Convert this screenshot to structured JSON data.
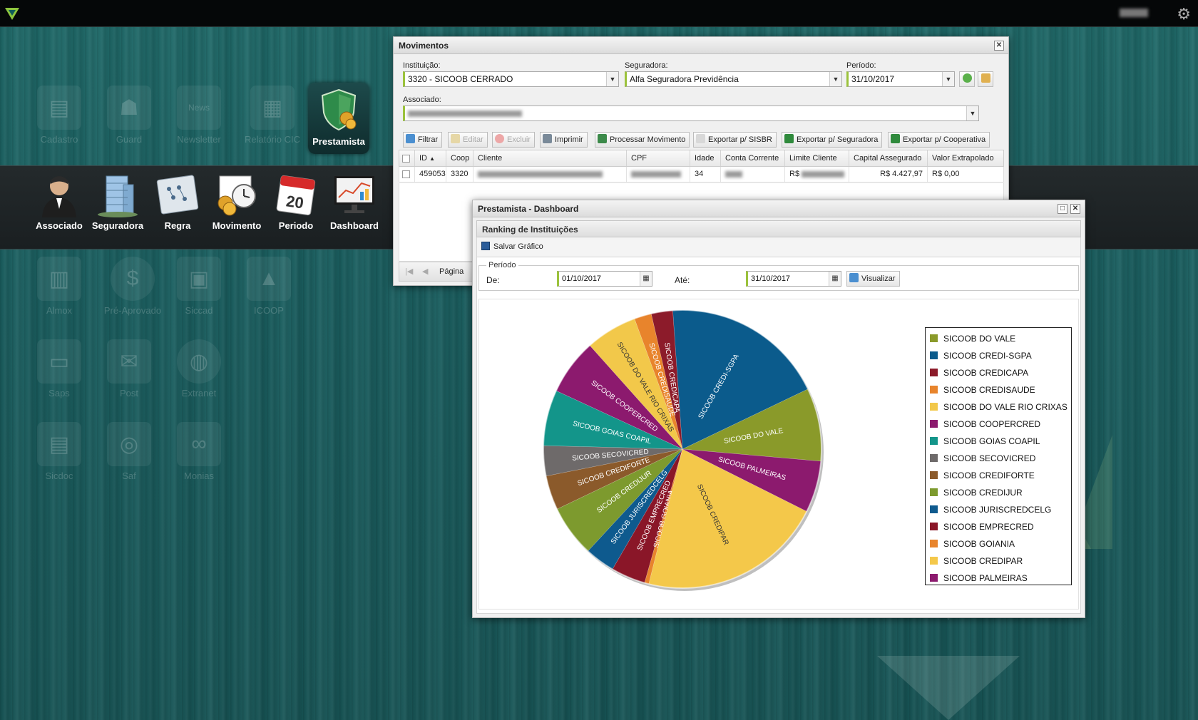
{
  "desktop": {
    "top_icons": [
      "Cadastro",
      "Guard",
      "Newsletter",
      "Relatório CIC"
    ],
    "active_app": "Prestamista",
    "ribbon": [
      "Associado",
      "Seguradora",
      "Regra",
      "Movimento",
      "Periodo",
      "Dashboard"
    ],
    "calendar_day": "20",
    "apps_row1": [
      "Almox",
      "Pré-Aprovado",
      "Siccad",
      "ICOOP"
    ],
    "apps_row2": [
      "Saps",
      "Post",
      "Extranet"
    ],
    "apps_row3": [
      "Sicdoc",
      "Saf",
      "Monias"
    ],
    "newsletter_badge": "News"
  },
  "movimentos": {
    "title": "Movimentos",
    "instituicao_label": "Instituição:",
    "instituicao_value": "3320 - SICOOB CERRADO",
    "seguradora_label": "Seguradora:",
    "seguradora_value": "Alfa Seguradora Previdência",
    "periodo_label": "Período:",
    "periodo_value": "31/10/2017",
    "associado_label": "Associado:",
    "toolbar": {
      "filtrar": "Filtrar",
      "editar": "Editar",
      "excluir": "Excluir",
      "imprimir": "Imprimir",
      "processar": "Processar Movimento",
      "sisbr": "Exportar p/ SISBR",
      "seguradora": "Exportar p/ Seguradora",
      "cooperativa": "Exportar p/ Cooperativa"
    },
    "columns": [
      "ID",
      "Coop",
      "Cliente",
      "CPF",
      "Idade",
      "Conta Corrente",
      "Limite Cliente",
      "Capital Assegurado",
      "Valor Extrapolado"
    ],
    "row": {
      "id": "459053",
      "coop": "3320",
      "idade": "34",
      "limite_prefix": "R$",
      "capital": "R$ 4.427,97",
      "extrapolado": "R$ 0,00"
    },
    "pager_label": "Página"
  },
  "dashboard": {
    "title": "Prestamista - Dashboard",
    "panel_title": "Ranking de Instituições",
    "save_label": "Salvar Gráfico",
    "periodo_legend": "Período",
    "de_label": "De:",
    "de_value": "01/10/2017",
    "ate_label": "Até:",
    "ate_value": "31/10/2017",
    "visualizar": "Visualizar"
  },
  "chart_data": {
    "type": "pie",
    "title": "",
    "legend_position": "right",
    "slices": [
      {
        "label": "SICOOB DO VALE",
        "value": 8.5,
        "color": "#8a9a2a"
      },
      {
        "label": "SICOOB CREDI-SGPA",
        "value": 19.0,
        "color": "#0b5b8c"
      },
      {
        "label": "SICOOB CREDICAPA",
        "value": 2.5,
        "color": "#8c1b2a"
      },
      {
        "label": "SICOOB CREDISAUDE",
        "value": 2.0,
        "color": "#e8842c"
      },
      {
        "label": "SICOOB DO VALE RIO CRIXAS",
        "value": 6.0,
        "color": "#f2c84a"
      },
      {
        "label": "SICOOB COOPERCRED",
        "value": 6.5,
        "color": "#8c1a6e"
      },
      {
        "label": "SICOOB GOIAS COAPIL",
        "value": 6.5,
        "color": "#13958a"
      },
      {
        "label": "SICOOB SECOVICRED",
        "value": 3.5,
        "color": "#6e6a6a"
      },
      {
        "label": "SICOOB CREDIFORTE",
        "value": 4.0,
        "color": "#8b5a2b"
      },
      {
        "label": "SICOOB CREDIJUR",
        "value": 6.0,
        "color": "#7d9a2e"
      },
      {
        "label": "SICOOB JURISCREDCELG",
        "value": 3.5,
        "color": "#0e5a8e"
      },
      {
        "label": "SICOOB EMPRECRED",
        "value": 4.0,
        "color": "#8a1628"
      },
      {
        "label": "SICOOB GOIANIA",
        "value": 0.5,
        "color": "#e8842c"
      },
      {
        "label": "SICOOB CREDIPAR",
        "value": 21.5,
        "color": "#f4c84a"
      },
      {
        "label": "SICOOB PALMEIRAS",
        "value": 6.0,
        "color": "#8c1a6e"
      }
    ]
  }
}
